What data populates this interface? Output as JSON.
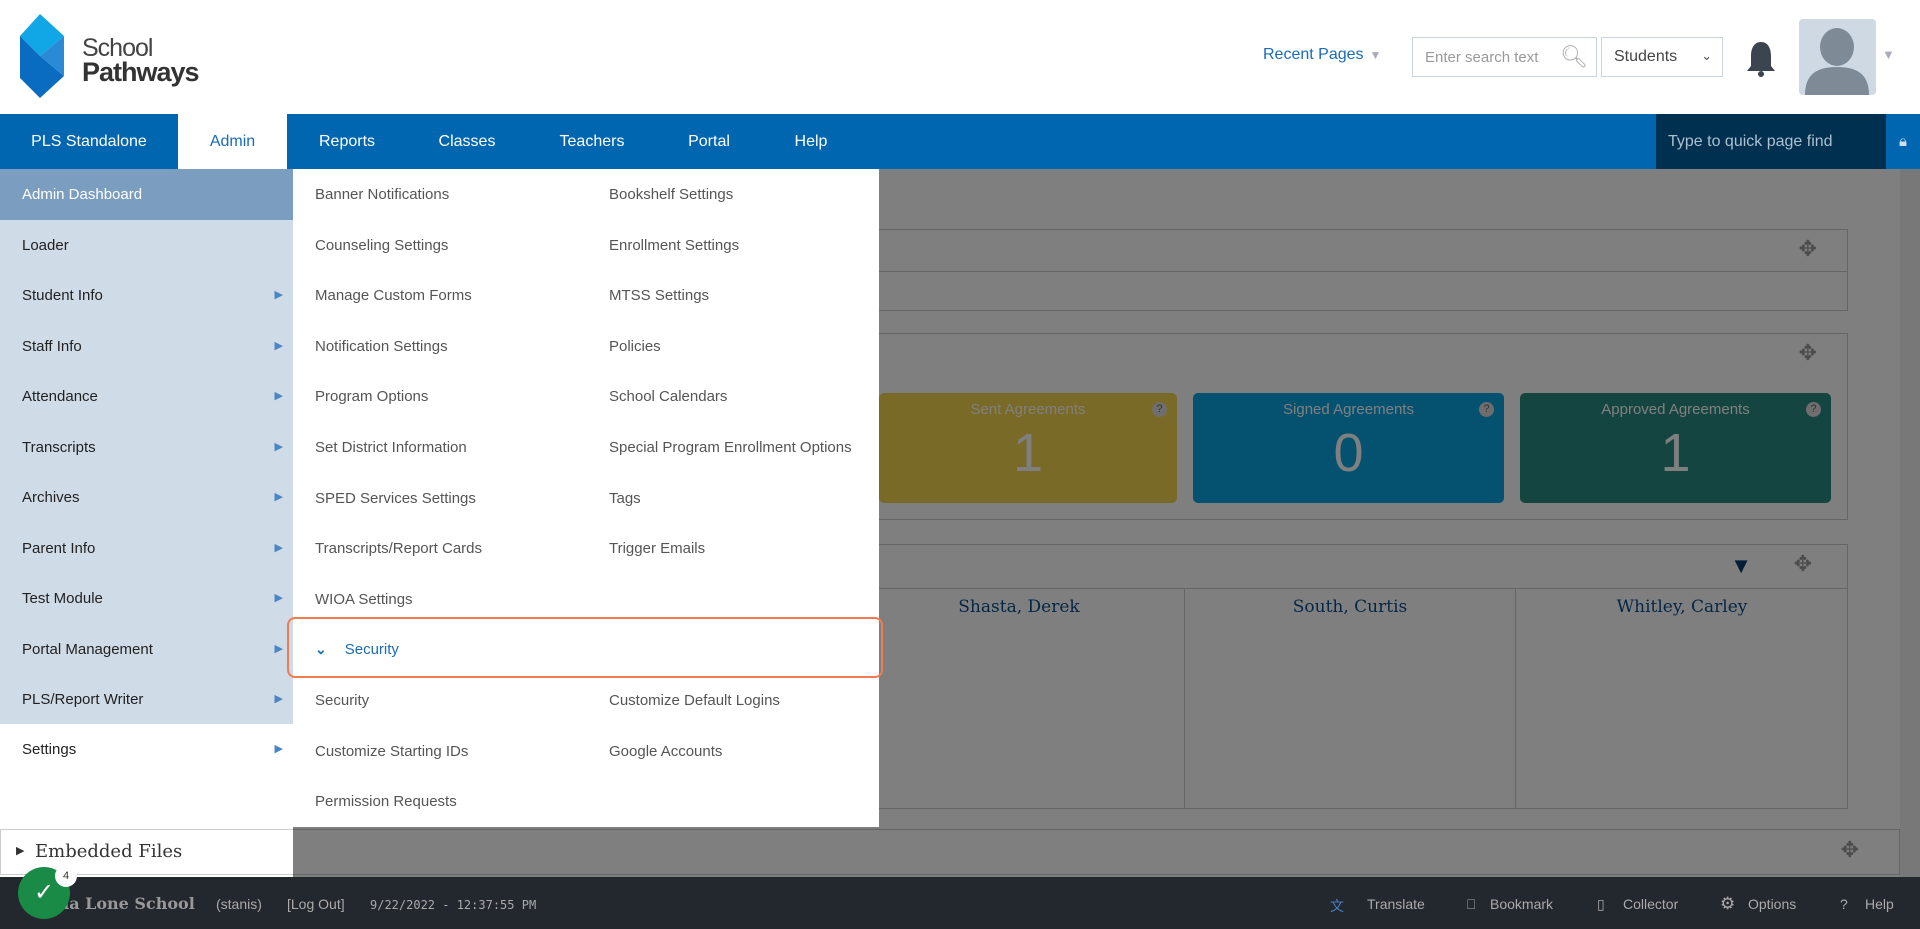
{
  "logo": {
    "line1": "School",
    "line2": "Pathways"
  },
  "header": {
    "recent_pages": "Recent Pages",
    "search_placeholder": "Enter search text",
    "search_scope": "Students"
  },
  "nav": {
    "items": [
      "PLS Standalone",
      "Admin",
      "Reports",
      "Classes",
      "Teachers",
      "Portal",
      "Help"
    ],
    "active": "Admin",
    "quick_find_placeholder": "Type to quick page find"
  },
  "sidebar": {
    "items": [
      {
        "label": "Admin Dashboard"
      },
      {
        "label": "Loader"
      },
      {
        "label": "Student Info"
      },
      {
        "label": "Staff Info"
      },
      {
        "label": "Attendance"
      },
      {
        "label": "Transcripts"
      },
      {
        "label": "Archives"
      },
      {
        "label": "Parent Info"
      },
      {
        "label": "Test Module"
      },
      {
        "label": "Portal Management"
      },
      {
        "label": "PLS/Report Writer"
      },
      {
        "label": "Settings"
      }
    ]
  },
  "menu": {
    "col1": [
      "Banner Notifications",
      "Counseling Settings",
      "Manage Custom Forms",
      "Notification Settings",
      "Program Options",
      "Set District Information",
      "SPED Services Settings",
      "Transcripts/Report Cards",
      "WIOA Settings"
    ],
    "col2": [
      "Bookshelf Settings",
      "Enrollment Settings",
      "MTSS Settings",
      "Policies",
      "School Calendars",
      "Special Program Enrollment Options",
      "Tags",
      "Trigger Emails"
    ],
    "section_header": "Security",
    "section_col1": [
      "Security",
      "Customize Starting IDs",
      "Permission Requests"
    ],
    "section_col2": [
      "Customize Default Logins",
      "Google Accounts"
    ]
  },
  "cards": [
    {
      "label": "Sent Agreements",
      "value": "1",
      "color": "#f5d54e"
    },
    {
      "label": "Signed Agreements",
      "value": "0",
      "color": "#0aa2e0"
    },
    {
      "label": "Approved Agreements",
      "value": "1",
      "color": "#2a8a80"
    }
  ],
  "students": [
    "Shasta, Derek",
    "South, Curtis",
    "Whitley, Carley"
  ],
  "embedded_files": "Embedded Files",
  "footer": {
    "school": "da Lone School",
    "user": "(stanis)",
    "logout": "[Log Out]",
    "datetime": "9/22/2022 - 12:37:55 PM",
    "translate": "Translate",
    "bookmark": "Bookmark",
    "collector": "Collector",
    "options": "Options",
    "help": "Help"
  },
  "badge": {
    "count": "4"
  }
}
